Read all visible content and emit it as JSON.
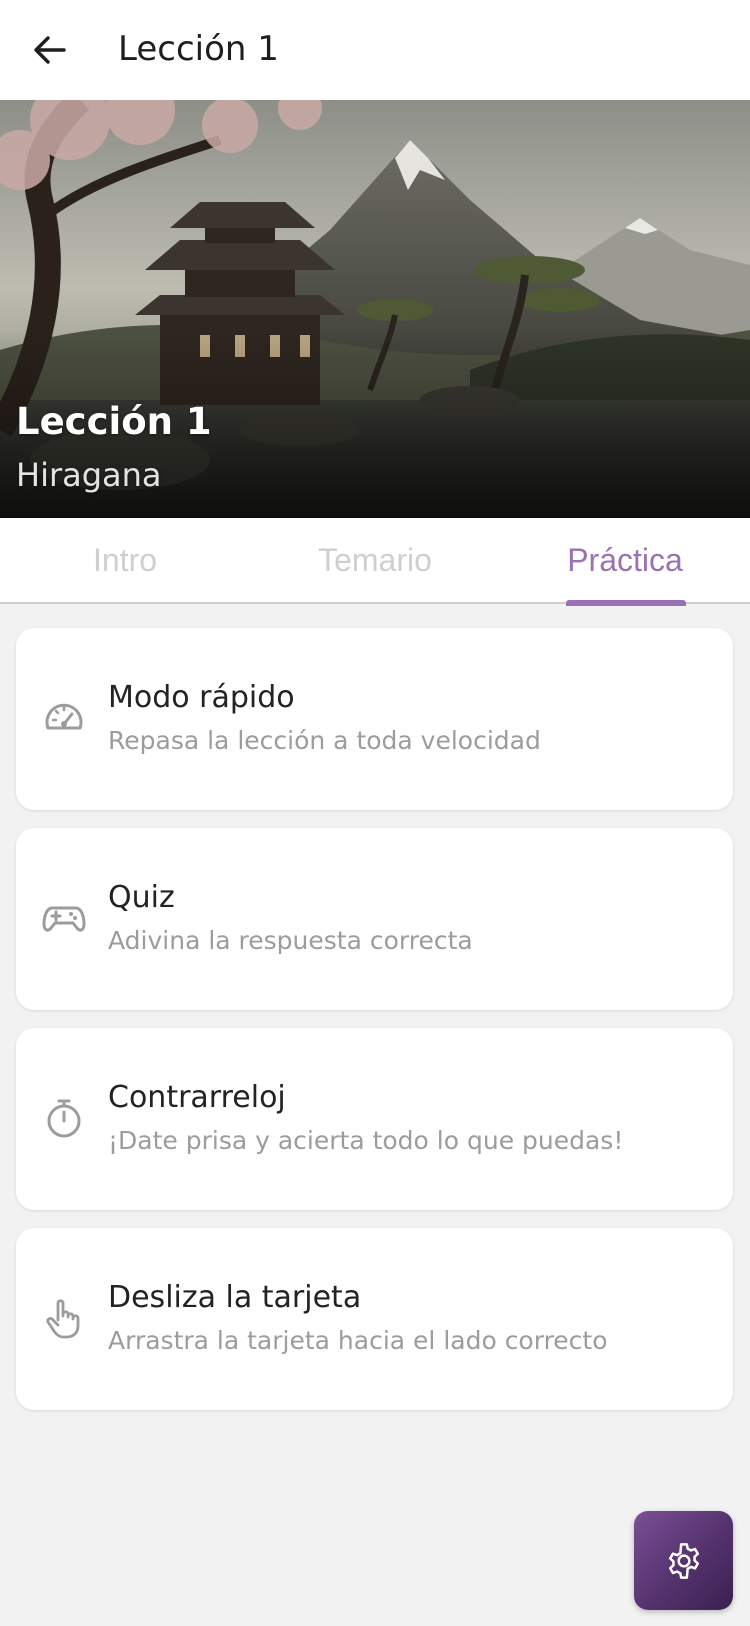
{
  "appbar": {
    "title": "Lección 1",
    "back_icon": "arrow-left-icon"
  },
  "hero": {
    "title": "Lección 1",
    "subtitle": "Hiragana",
    "image": "japanese-landscape-mountain-pagoda"
  },
  "tabs": [
    {
      "label": "Intro",
      "active": false
    },
    {
      "label": "Temario",
      "active": false
    },
    {
      "label": "Práctica",
      "active": true
    }
  ],
  "practice_modes": [
    {
      "title": "Modo rápido",
      "description": "Repasa la lección a toda velocidad",
      "icon": "speedometer-icon"
    },
    {
      "title": "Quiz",
      "description": "Adivina la respuesta correcta",
      "icon": "gamepad-icon"
    },
    {
      "title": "Contrarreloj",
      "description": "¡Date prisa y acierta todo lo que puedas!",
      "icon": "stopwatch-icon"
    },
    {
      "title": "Desliza la tarjeta",
      "description": "Arrastra la tarjeta hacia el lado correcto",
      "icon": "hand-pointer-icon"
    }
  ],
  "fab": {
    "icon": "gear-icon"
  },
  "colors": {
    "accent": "#9a71b4",
    "fab_gradient_start": "#7b4f96",
    "fab_gradient_end": "#3a2150",
    "background": "#f2f2f2"
  }
}
